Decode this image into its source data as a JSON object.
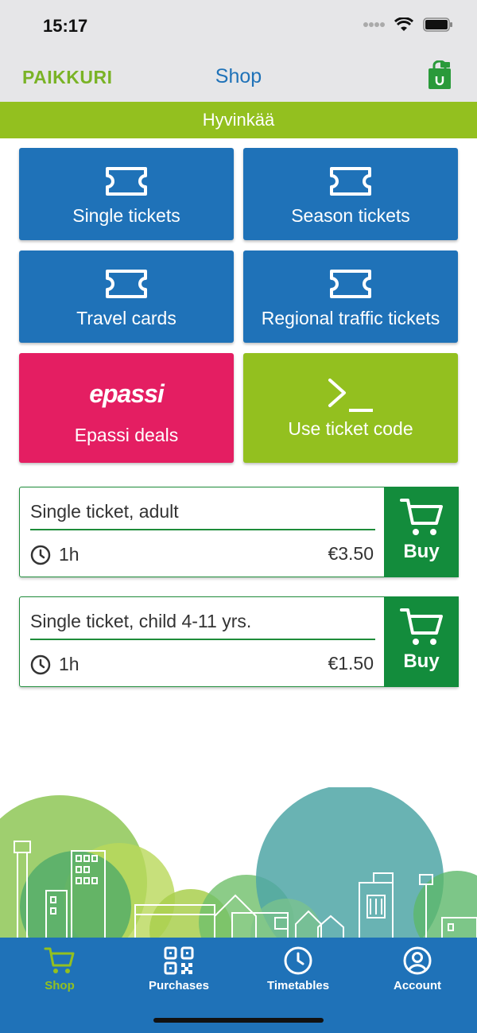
{
  "status_bar": {
    "time": "15:17"
  },
  "header": {
    "logo": "PAIKKURI",
    "title": "Shop"
  },
  "region": "Hyvinkää",
  "tiles": [
    {
      "label": "Single tickets",
      "icon": "ticket-icon"
    },
    {
      "label": "Season tickets",
      "icon": "ticket-icon"
    },
    {
      "label": "Travel cards",
      "icon": "ticket-icon"
    },
    {
      "label": "Regional traffic tickets",
      "icon": "ticket-icon"
    },
    {
      "label": "Epassi deals",
      "logo_text": "epassi",
      "icon": "epassi-logo"
    },
    {
      "label": "Use ticket code",
      "icon": "terminal-prompt-icon"
    }
  ],
  "tickets": [
    {
      "name": "Single ticket, adult",
      "duration": "1h",
      "price": "€3.50",
      "buy_label": "Buy"
    },
    {
      "name": "Single ticket, child 4-11 yrs.",
      "duration": "1h",
      "price": "€1.50",
      "buy_label": "Buy"
    }
  ],
  "tabbar": {
    "items": [
      {
        "label": "Shop",
        "icon": "cart-icon",
        "active": true
      },
      {
        "label": "Purchases",
        "icon": "qr-code-icon",
        "active": false
      },
      {
        "label": "Timetables",
        "icon": "clock-icon",
        "active": false
      },
      {
        "label": "Account",
        "icon": "user-icon",
        "active": false
      }
    ]
  },
  "colors": {
    "brand_blue": "#1f72b8",
    "brand_green": "#93c01f",
    "epassi_pink": "#e41e62",
    "buy_green": "#138c3c",
    "header_gray": "#e6e6e8"
  }
}
